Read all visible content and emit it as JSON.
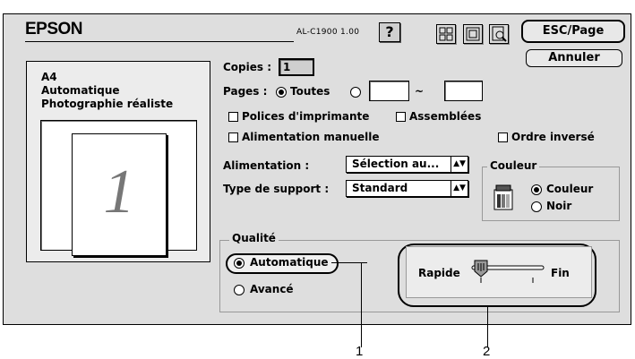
{
  "header": {
    "logo": "EPSON",
    "model": "AL-C1900  1.00",
    "help_label": "?",
    "esc_page_label": "ESC/Page",
    "cancel_label": "Annuler"
  },
  "summary": {
    "line1": "A4",
    "line2": "Automatique",
    "line3": "Photographie réaliste",
    "preview_number": "1"
  },
  "copies": {
    "label": "Copies :",
    "value": "1"
  },
  "pages": {
    "label": "Pages :",
    "all_label": "Toutes",
    "from": "",
    "to": "",
    "separator": "~"
  },
  "options": {
    "printer_fonts": "Polices d'imprimante",
    "collate": "Assemblées",
    "manual_feed": "Alimentation manuelle",
    "reverse_order": "Ordre inversé"
  },
  "paper_source": {
    "label": "Alimentation :",
    "value": "Sélection au..."
  },
  "media_type": {
    "label": "Type de support :",
    "value": "Standard"
  },
  "color": {
    "title": "Couleur",
    "color_label": "Couleur",
    "black_label": "Noir"
  },
  "quality": {
    "title": "Qualité",
    "auto_label": "Automatique",
    "advanced_label": "Avancé",
    "fast_label": "Rapide",
    "fine_label": "Fin",
    "slider_level": 0.0
  },
  "callouts": {
    "one": "1",
    "two": "2"
  }
}
